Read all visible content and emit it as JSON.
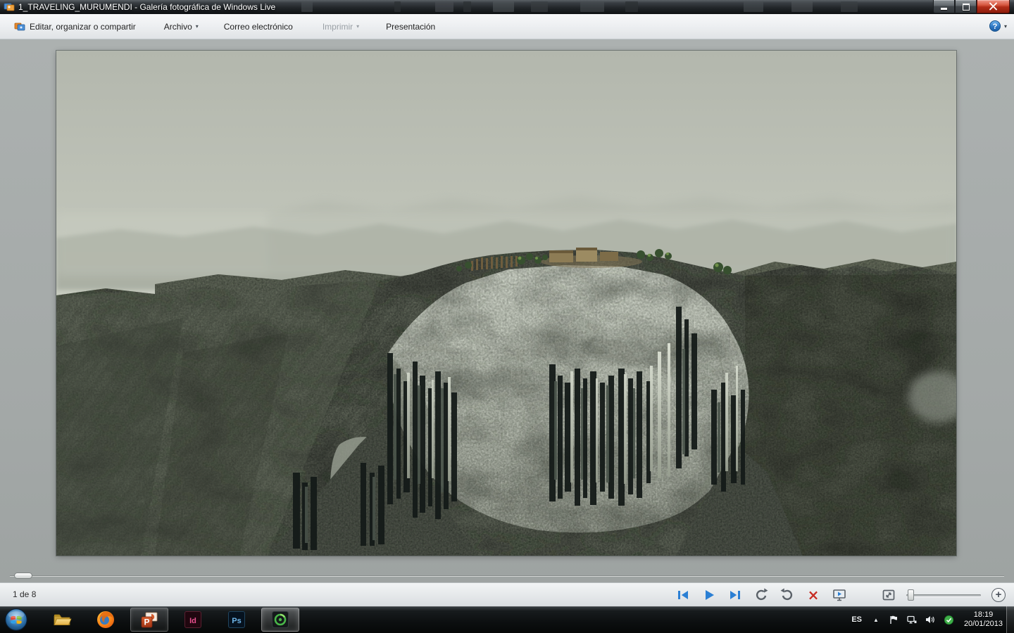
{
  "window": {
    "title": "1_TRAVELING_MURUMENDI - Galería fotográfica de Windows Live"
  },
  "toolbar": {
    "edit_label": "Editar, organizar o compartir",
    "file_label": "Archivo",
    "email_label": "Correo electrónico",
    "print_label": "Imprimir",
    "slideshow_label": "Presentación",
    "dropdown_glyph": "▾",
    "help_glyph": "?"
  },
  "statusbar": {
    "counter": "1 de 8",
    "delete_glyph": "×",
    "zoom_plus_glyph": "+"
  },
  "taskbar": {
    "powerpoint_label": "P",
    "indesign_label": "Id",
    "photoshop_label": "Ps"
  },
  "tray": {
    "language": "ES",
    "hidden_icons_glyph": "▲",
    "time": "18:19",
    "date": "20/01/2013"
  },
  "colors": {
    "accent_blue": "#2a7fd4",
    "delete_red": "#c62f26",
    "close_button_red": "#c1301a",
    "taskbar_black": "#0c0f10",
    "content_gray": "#a5aaa9"
  }
}
